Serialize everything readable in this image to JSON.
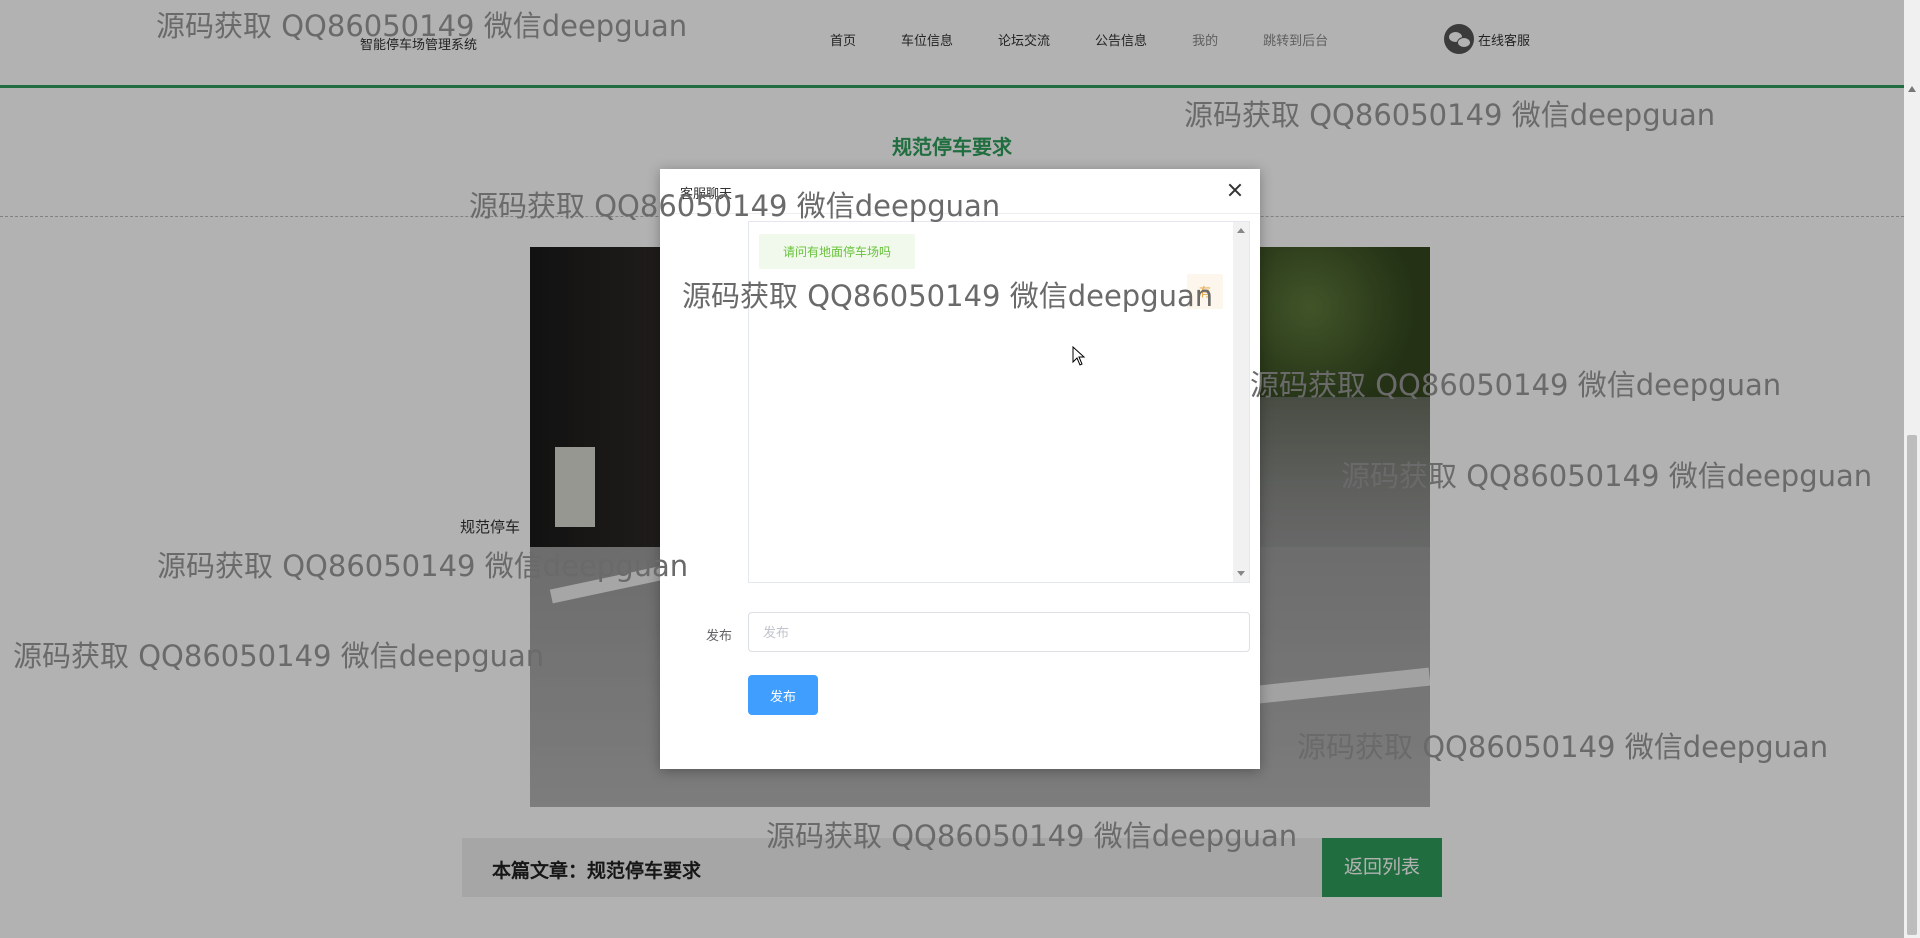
{
  "header": {
    "brand": "智能停车场管理系统",
    "nav": [
      "首页",
      "车位信息",
      "论坛交流",
      "公告信息",
      "我的",
      "跳转到后台"
    ],
    "service_label": "在线客服"
  },
  "article": {
    "title": "规范停车要求",
    "image_caption": "规范停车",
    "bottom_label": "本篇文章：规范停车要求",
    "back_label": "返回列表"
  },
  "dialog": {
    "title": "客服聊天",
    "messages": [
      {
        "side": "left",
        "text": "请问有地面停车场吗"
      },
      {
        "side": "right",
        "text": "有"
      }
    ],
    "form_label": "发布",
    "input_placeholder": "发布",
    "input_value": "",
    "submit_label": "发布"
  },
  "watermark": "源码获取 QQ86050149 微信deepguan",
  "colors": {
    "accent": "#2f9e5b",
    "primary_button": "#409eff",
    "msg_left_bg": "#f0f9eb",
    "msg_left_text": "#67c23a",
    "msg_right_bg": "#fdf6ec",
    "msg_right_text": "#e6a23c"
  }
}
